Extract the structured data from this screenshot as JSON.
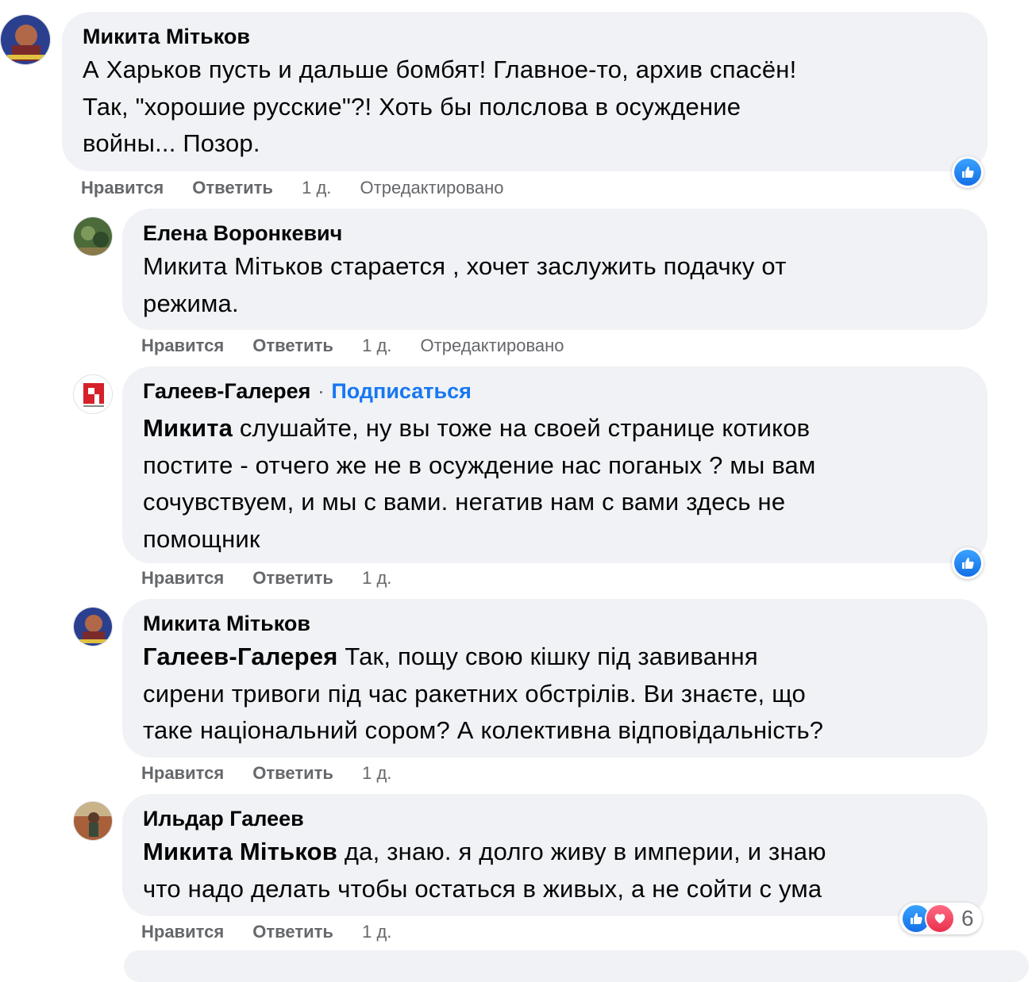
{
  "labels": {
    "like": "Нравится",
    "reply": "Ответить",
    "edited": "Отредактировано",
    "follow": "Подписаться",
    "dot": "·"
  },
  "comments": [
    {
      "author": "Микита Мітьков",
      "lines": [
        "А Харьков пусть и дальше бомбят! Главное-то, архив спасён!",
        "Так, \"хорошие русские\"?! Хоть бы полслова в осуждение",
        "войны... Позор."
      ],
      "time": "1 д."
    },
    {
      "author": "Елена Воронкевич",
      "lines": [
        "Микита Мітьков старается , хочет заслужить подачку от",
        "режима."
      ],
      "time": "1 д."
    },
    {
      "author": "Галеев-Галерея",
      "mention": "Микита",
      "lines": [
        " слушайте, ну вы тоже на своей странице котиков",
        "постите - отчего же не в осуждение нас поганых ? мы вам",
        "сочувствуем, и мы с вами. негатив нам с вами здесь не",
        "помощник"
      ],
      "time": "1 д."
    },
    {
      "author": "Микита Мітьков",
      "mention": "Галеев-Галерея",
      "lines": [
        " Так, пощу свою кішку під завивання",
        "сирени тривоги під час ракетних обстрілів. Ви знаєте, що",
        "таке національний сором? А колективна відповідальність?"
      ],
      "time": "1 д."
    },
    {
      "author": "Ильдар Галеев",
      "mention": "Микита Мітьков",
      "lines": [
        " да, знаю. я долго живу в империи, и знаю",
        "что надо делать чтобы остаться в живых, а не сойти с ума"
      ],
      "time": "1 д.",
      "reaction_count": "6"
    }
  ],
  "colors": {
    "link": "#1877f2",
    "bubble": "#f0f2f5",
    "secondary": "#65676b",
    "like": "#1877f2",
    "love": "#f33e58"
  }
}
